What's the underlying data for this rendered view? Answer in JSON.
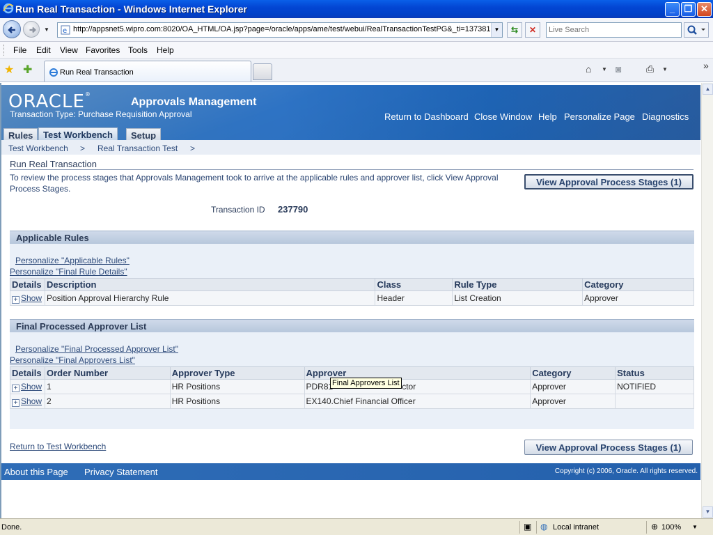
{
  "window": {
    "title": "Run Real Transaction - Windows Internet Explorer",
    "buttons": [
      "_",
      "❐",
      "✕"
    ]
  },
  "address": {
    "url": "http://appsnet5.wipro.com:8020/OA_HTML/OA.jsp?page=/oracle/apps/ame/test/webui/RealTransactionTestPG&_ti=137381",
    "search_placeholder": "Live Search"
  },
  "menu": [
    "File",
    "Edit",
    "View",
    "Favorites",
    "Tools",
    "Help"
  ],
  "browser_tab": {
    "label": "Run Real Transaction"
  },
  "header": {
    "logo": "ORACLE",
    "app_title": "Approvals Management",
    "transaction_type": "Transaction Type: Purchase Requisition Approval",
    "global_links": [
      "Return to Dashboard",
      "Close Window",
      "Help",
      "Personalize Page",
      "Diagnostics"
    ]
  },
  "tabs": [
    "Rules",
    "Test Workbench",
    "Setup"
  ],
  "breadcrumbs": [
    "Test Workbench",
    "Real Transaction Test"
  ],
  "breadcrumb_separator": ">",
  "page": {
    "title": "Run Real Transaction",
    "instruction": "To review the process stages that Approvals Management took to arrive at the applicable rules and approver list, click View Approval Process Stages.",
    "view_stages_button": "View Approval Process Stages (1)",
    "transaction_id_label": "Transaction ID",
    "transaction_id": "237790",
    "return_link": "Return to Test Workbench"
  },
  "applicable_rules": {
    "title": "Applicable Rules",
    "personalize_links": [
      "Personalize \"Applicable Rules\"",
      "Personalize \"Final Rule Details\""
    ],
    "columns": [
      "Details",
      "Description",
      "Class",
      "Rule Type",
      "Category"
    ],
    "rows": [
      {
        "details": "Show",
        "description": "Position Approval Hierarchy Rule",
        "class": "Header",
        "rule_type": "List Creation",
        "category": "Approver"
      }
    ]
  },
  "approver_list": {
    "title": "Final Processed Approver List",
    "personalize_links": [
      "Personalize \"Final Processed Approver List\"",
      "Personalize \"Final Approvers List\""
    ],
    "columns": [
      "Details",
      "Order Number",
      "Approver Type",
      "Approver",
      "Category",
      "Status"
    ],
    "rows": [
      {
        "details": "Show",
        "order": "1",
        "approver_type": "HR Positions",
        "approver": "PDR81",
        "approver_suffix": "ctor",
        "category": "Approver",
        "status": "NOTIFIED"
      },
      {
        "details": "Show",
        "order": "2",
        "approver_type": "HR Positions",
        "approver": "EX140.Chief Financial Officer",
        "approver_suffix": "",
        "category": "Approver",
        "status": ""
      }
    ]
  },
  "tooltip": "Final Approvers List",
  "footer": {
    "links": [
      "About this Page",
      "Privacy Statement"
    ],
    "copyright": "Copyright (c) 2006, Oracle. All rights reserved."
  },
  "statusbar": {
    "status": "Done.",
    "zone": "Local intranet",
    "zoom": "100%"
  },
  "colors": {
    "brand_blue": "#2e73c4",
    "link": "#2d4a7a",
    "region_header": "#b7c7dc"
  }
}
